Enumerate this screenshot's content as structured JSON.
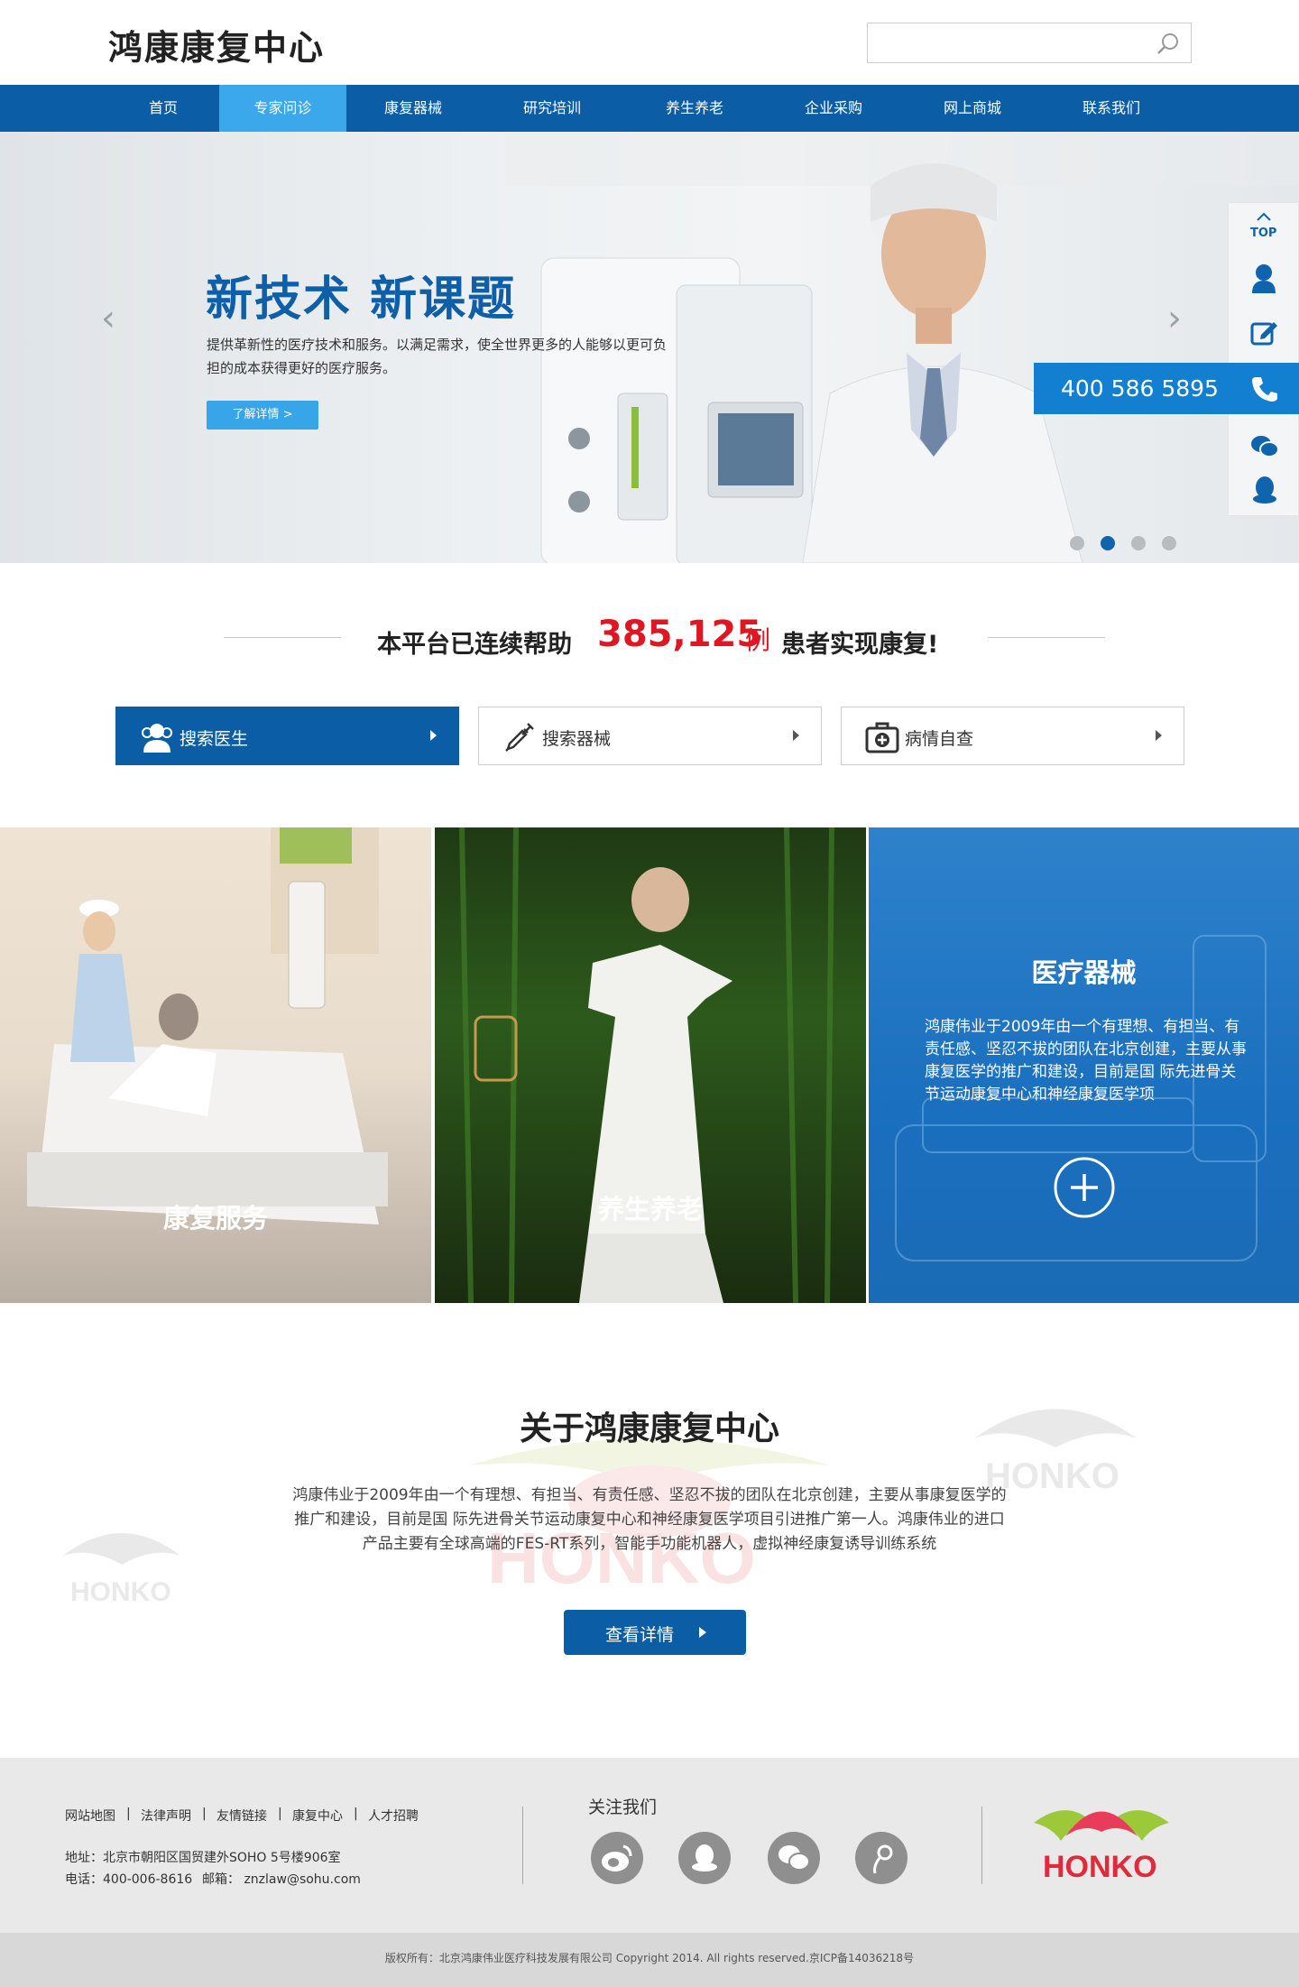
{
  "header": {
    "logo": "鸿康康复中心",
    "search": {
      "placeholder": "",
      "icon": "search-icon"
    }
  },
  "nav": {
    "items": [
      "首页",
      "专家问诊",
      "康复器械",
      "研究培训",
      "养生养老",
      "企业采购",
      "网上商城",
      "联系我们"
    ],
    "active_index": 1
  },
  "banner": {
    "title": "新技术  新课题",
    "desc": "提供革新性的医疗技术和服务。以满足需求，使全世界更多的人能够以更可负担的成本获得更好的医疗服务。",
    "button": "了解详情 >",
    "slides": 4,
    "active_slide": 2
  },
  "sidebar": {
    "top_label": "TOP",
    "phone": "400 586 5895",
    "icons": [
      "arrow-up-icon",
      "user-icon",
      "edit-icon",
      "phone-icon",
      "wechat-icon",
      "qq-icon"
    ]
  },
  "stats": {
    "prefix": "本平台已连续帮助",
    "count": "385,125",
    "unit": "例",
    "suffix": "患者实现康复!"
  },
  "quick": [
    {
      "label": "搜索医生",
      "icon": "doctor-icon"
    },
    {
      "label": "搜索器械",
      "icon": "syringe-icon"
    },
    {
      "label": "病情自查",
      "icon": "medkit-icon"
    }
  ],
  "panels": [
    {
      "title": "康复服务"
    },
    {
      "title": "养生养老"
    },
    {
      "title": "医疗器械",
      "desc": "鸿康伟业于2009年由一个有理想、有担当、有责任感、坚忍不拔的团队在北京创建，主要从事康复医学的推广和建设，目前是国  际先进骨关节运动康复中心和神经康复医学项"
    }
  ],
  "about": {
    "title": "关于鸿康康复中心",
    "text": "鸿康伟业于2009年由一个有理想、有担当、有责任感、坚忍不拔的团队在北京创建，主要从事康复医学的推广和建设，目前是国 际先进骨关节运动康复中心和神经康复医学项目引进推广第一人。鸿康伟业的进口产品主要有全球高端的FES-RT系列，智能手功能机器人，虚拟神经康复诱导训练系统",
    "button": "查看详情",
    "watermark": "HONKO"
  },
  "footer": {
    "links": [
      "网站地图",
      "法律声明",
      "友情链接",
      "康复中心",
      "人才招聘"
    ],
    "address": "地址：北京市朝阳区国贸建外SOHO 5号楼906室",
    "phone": "电话：400-006-8616",
    "email": "邮箱： znzlaw@sohu.com",
    "follow": "关注我们",
    "social": [
      "weibo-icon",
      "qq-icon",
      "wechat-icon",
      "tencent-weibo-icon"
    ],
    "brand": "HONKO",
    "copyright": "版权所有：北京鸿康伟业医疗科技发展有限公司      Copyright 2014. All rights reserved.京ICP备14036218号"
  }
}
